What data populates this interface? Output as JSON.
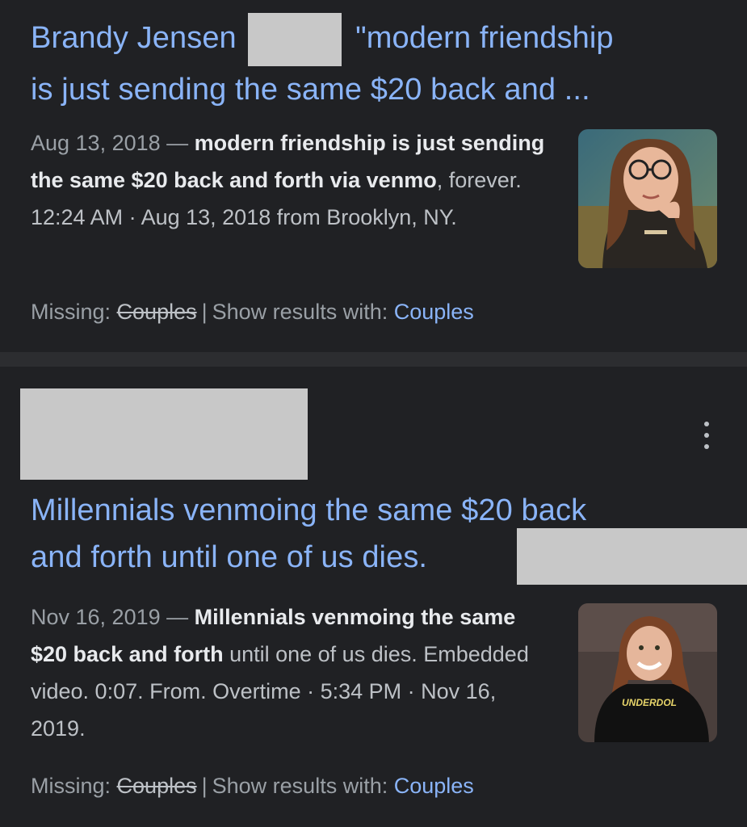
{
  "results": [
    {
      "title_line1_start": "Brandy Jensen",
      "title_line1_end": "\"modern friendship",
      "title_line2": "is just sending the same $20 back and ...",
      "date": "Aug 13, 2018 —",
      "snippet_bold_1": "modern friendship is just sending the same $20 back and forth via venmo",
      "snippet_rest": ", forever. 12:24 AM · Aug 13, 2018 from Brooklyn, NY.",
      "missing_label": "Missing:",
      "missing_term": "Couples",
      "show_results_label": "Show results with:",
      "show_results_link": "Couples"
    },
    {
      "title_line1": "Millennials venmoing the same $20 back",
      "title_line2": "and forth until one of us dies.",
      "date": "Nov 16, 2019 —",
      "snippet_bold_1": "Millennials venmoing the same $20 back and forth",
      "snippet_rest": " until one of us dies. Embedded video. 0:07. From. Overtime · 5:34 PM · Nov 16, 2019.",
      "thumb_shirt_text": "UNDERDOL",
      "missing_label": "Missing:",
      "missing_term": "Couples",
      "show_results_label": "Show results with:",
      "show_results_link": "Couples"
    }
  ]
}
